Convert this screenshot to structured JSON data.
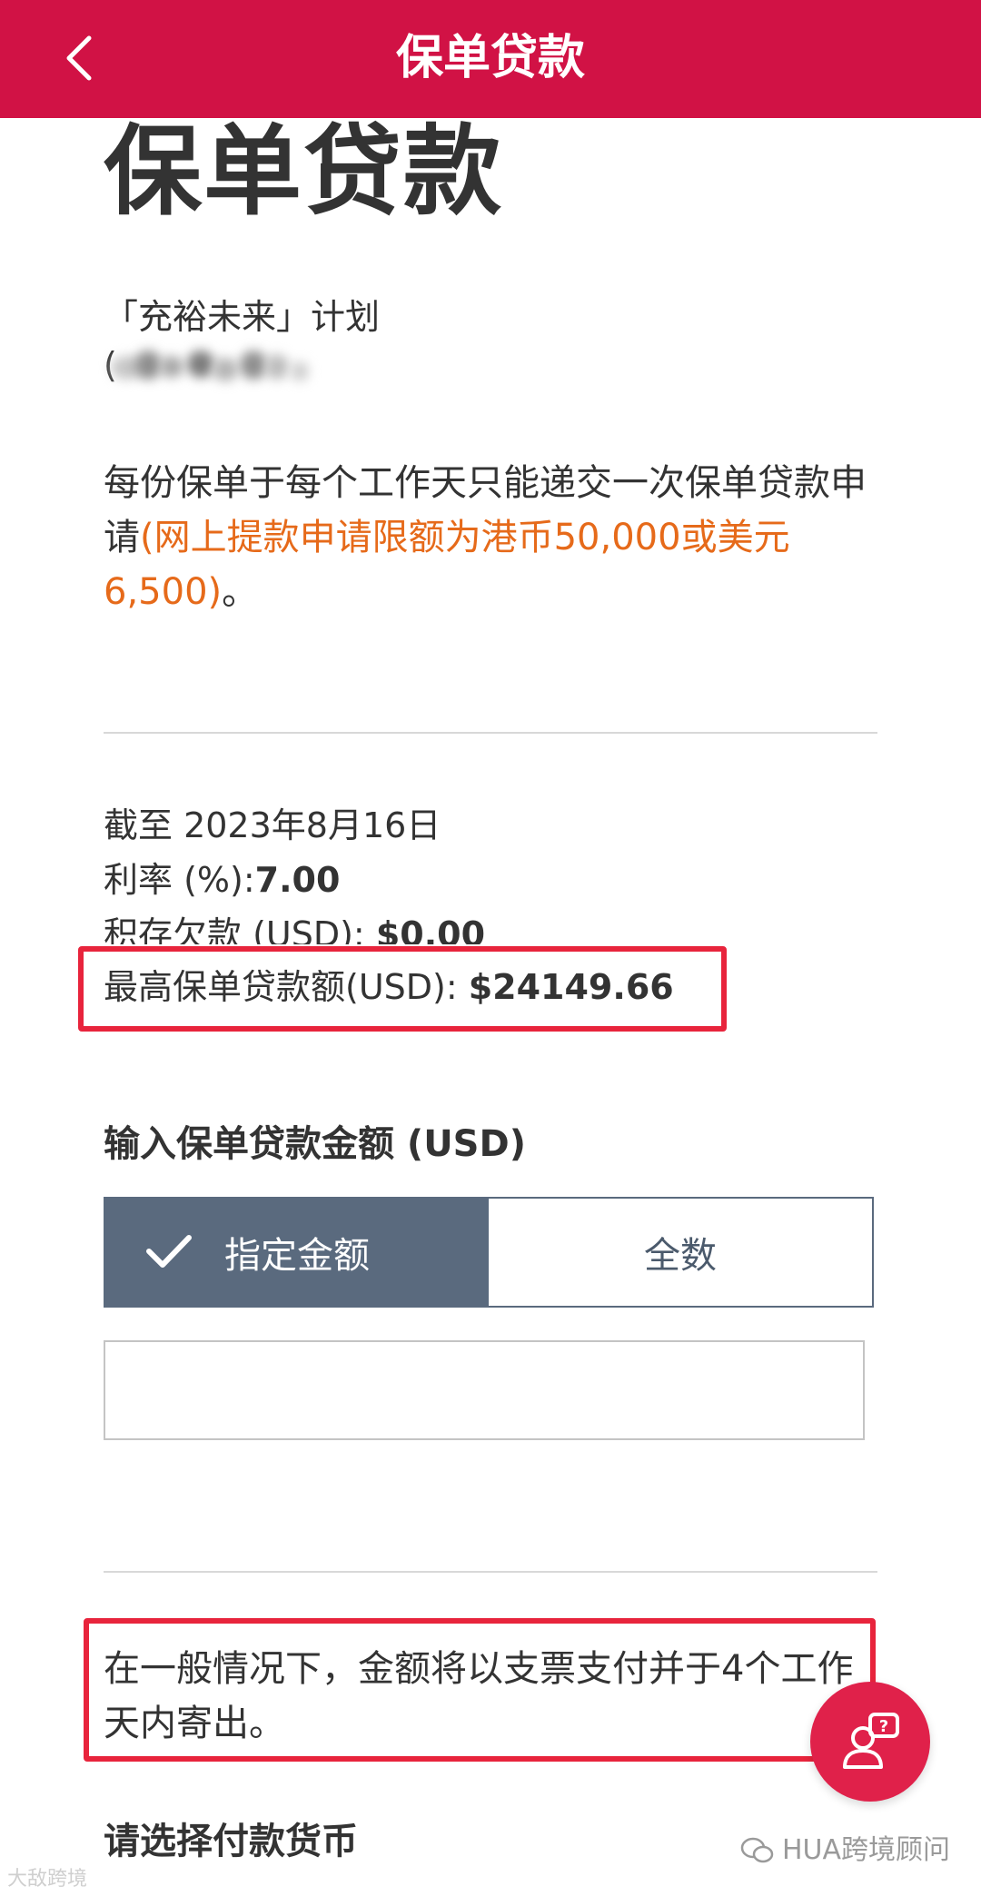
{
  "header": {
    "title": "保单贷款"
  },
  "page": {
    "title": "保单贷款",
    "plan_name": "「充裕未来」计划",
    "policy_number_redacted": "("
  },
  "notice": {
    "text_main": "每份保单于每个工作天只能递交一次保单贷款申请",
    "text_orange": "(网上提款申请限额为港币50,000或美元6,500)",
    "text_end": "。"
  },
  "loan_info": {
    "as_of": "截至 2023年8月16日",
    "interest_label": "利率 (%):",
    "interest_value": "7.00",
    "outstanding_label": "积存欠款 (USD): ",
    "outstanding_value": "$0.00",
    "max_label": "最高保单贷款额(USD): ",
    "max_value": "$24149.66"
  },
  "amount_section": {
    "heading": "输入保单贷款金额 (USD)",
    "option_specified": "指定金额",
    "option_full": "全数",
    "selected": "指定金额",
    "input_value": "",
    "input_placeholder": ""
  },
  "payment_note": {
    "text": "在一般情况下，金额将以支票支付并于4个工作天内寄出。"
  },
  "currency_section": {
    "heading": "请选择付款货币"
  },
  "watermarks": {
    "right": "HUA跨境顾问",
    "left": "大敌跨境"
  },
  "colors": {
    "brand_red": "#d11245",
    "orange": "#e66a1a",
    "toggle_selected": "#5a6a7e",
    "highlight_red": "#e8243c"
  }
}
